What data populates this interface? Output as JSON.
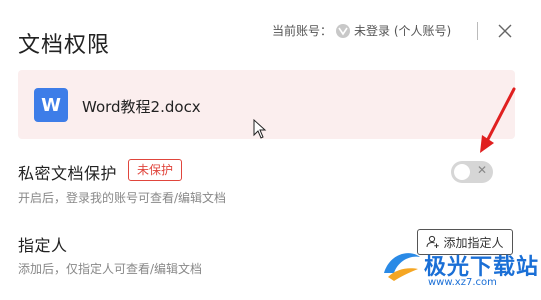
{
  "dialog": {
    "title": "文档权限",
    "account_label": "当前账号：",
    "account_status": "未登录 (个人账号)",
    "close_icon": "close-icon"
  },
  "file": {
    "icon_letter": "W",
    "name": "Word教程2.docx",
    "icon_color": "#3d7de8"
  },
  "private_protection": {
    "title": "私密文档保护",
    "badge": "未保护",
    "description": "开启后，登录我的账号可查看/编辑文档",
    "toggle_on": false
  },
  "designated_person": {
    "title": "指定人",
    "description": "添加后，仅指定人可查看/编辑文档",
    "add_button": "添加指定人"
  },
  "watermark": {
    "text": "极光下载站",
    "url": "www.xz7.com"
  },
  "colors": {
    "accent_red": "#e0453c",
    "card_bg": "#fbeeee",
    "toggle_off": "#d6d6d6"
  }
}
